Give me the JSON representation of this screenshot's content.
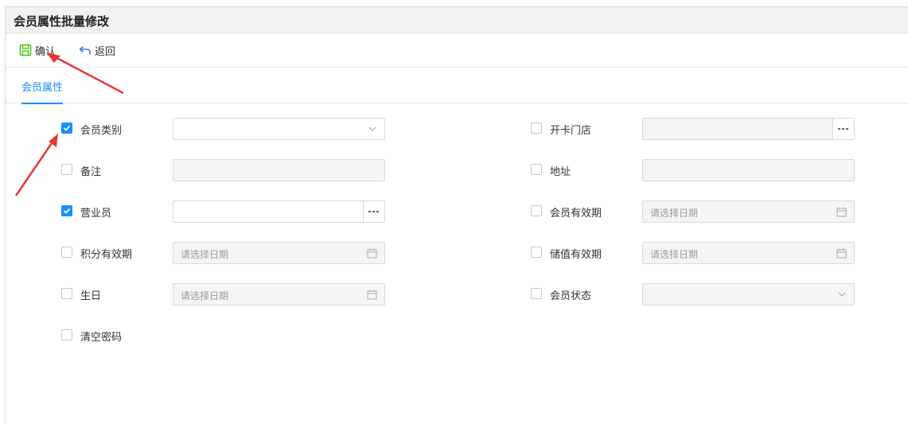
{
  "window": {
    "title": "会员属性批量修改"
  },
  "toolbar": {
    "confirm_label": "确认",
    "back_label": "返回"
  },
  "tabs": [
    {
      "label": "会员属性",
      "active": true
    }
  ],
  "colors": {
    "accent": "#1890ff",
    "save_icon": "#52c41a",
    "annotation_arrow": "#e53935"
  },
  "left_fields": [
    {
      "label": "会员类别",
      "checked": true,
      "control": "select",
      "value": ""
    },
    {
      "label": "备注",
      "checked": false,
      "control": "text-disabled",
      "value": ""
    },
    {
      "label": "营业员",
      "checked": true,
      "control": "picker",
      "value": ""
    },
    {
      "label": "积分有效期",
      "checked": false,
      "control": "date",
      "placeholder": "请选择日期"
    },
    {
      "label": "生日",
      "checked": false,
      "control": "date",
      "placeholder": "请选择日期"
    },
    {
      "label": "清空密码",
      "checked": false,
      "control": "none"
    }
  ],
  "right_fields": [
    {
      "label": "开卡门店",
      "checked": false,
      "control": "picker-disabled",
      "value": ""
    },
    {
      "label": "地址",
      "checked": false,
      "control": "text-disabled",
      "value": ""
    },
    {
      "label": "会员有效期",
      "checked": false,
      "control": "date",
      "placeholder": "请选择日期"
    },
    {
      "label": "储值有效期",
      "checked": false,
      "control": "date",
      "placeholder": "请选择日期"
    },
    {
      "label": "会员状态",
      "checked": false,
      "control": "select-disabled",
      "value": ""
    }
  ]
}
